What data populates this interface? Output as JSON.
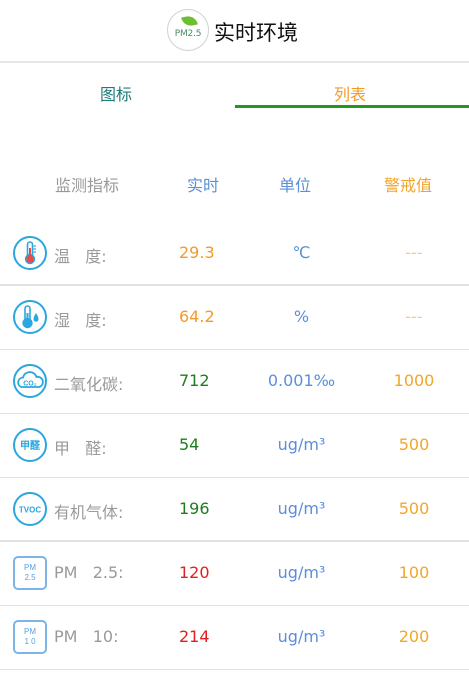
{
  "header": {
    "logo_text": "PM2.5",
    "title": "实时环境"
  },
  "tabs": [
    {
      "label": "图标"
    },
    {
      "label": "列表"
    }
  ],
  "columns": {
    "indicator": "监测指标",
    "realtime": "实时",
    "unit": "单位",
    "alert": "警戒值"
  },
  "rows": [
    {
      "icon": "thermometer-icon",
      "icon_text": "",
      "name": "温   度:",
      "value": "29.3",
      "value_color": "#f39a2a",
      "unit": "℃",
      "alert": "---",
      "alert_color": "#f5c98a"
    },
    {
      "icon": "humidity-thermometer-icon",
      "icon_text": "",
      "name": "湿   度:",
      "value": "64.2",
      "value_color": "#f39a2a",
      "unit": "%",
      "alert": "---",
      "alert_color": "#f5c98a"
    },
    {
      "icon": "co2-cloud-icon",
      "icon_text": "CO₂",
      "name": "二氧化碳:",
      "value": "712",
      "value_color": "#1e7d1e",
      "unit": "0.001‰",
      "alert": "1000",
      "alert_color": "#f3a52a"
    },
    {
      "icon": "formaldehyde-icon",
      "icon_text": "甲醛",
      "name": "甲   醛:",
      "value": "54",
      "value_color": "#1e7d1e",
      "unit": "ug/m³",
      "alert": "500",
      "alert_color": "#f3a52a"
    },
    {
      "icon": "tvoc-icon",
      "icon_text": "TVOC",
      "name": "有机气体:",
      "value": "196",
      "value_color": "#1e7d1e",
      "unit": "ug/m³",
      "alert": "500",
      "alert_color": "#f3a52a"
    },
    {
      "icon": "pm25-icon",
      "icon_text": "PM 2.5",
      "name": "PM   2.5:",
      "value": "120",
      "value_color": "#e02020",
      "unit": "ug/m³",
      "alert": "100",
      "alert_color": "#f3a52a"
    },
    {
      "icon": "pm10-icon",
      "icon_text": "PM 1 0",
      "name": "PM   10:",
      "value": "214",
      "value_color": "#e02020",
      "unit": "ug/m³",
      "alert": "200",
      "alert_color": "#f3a52a"
    }
  ]
}
